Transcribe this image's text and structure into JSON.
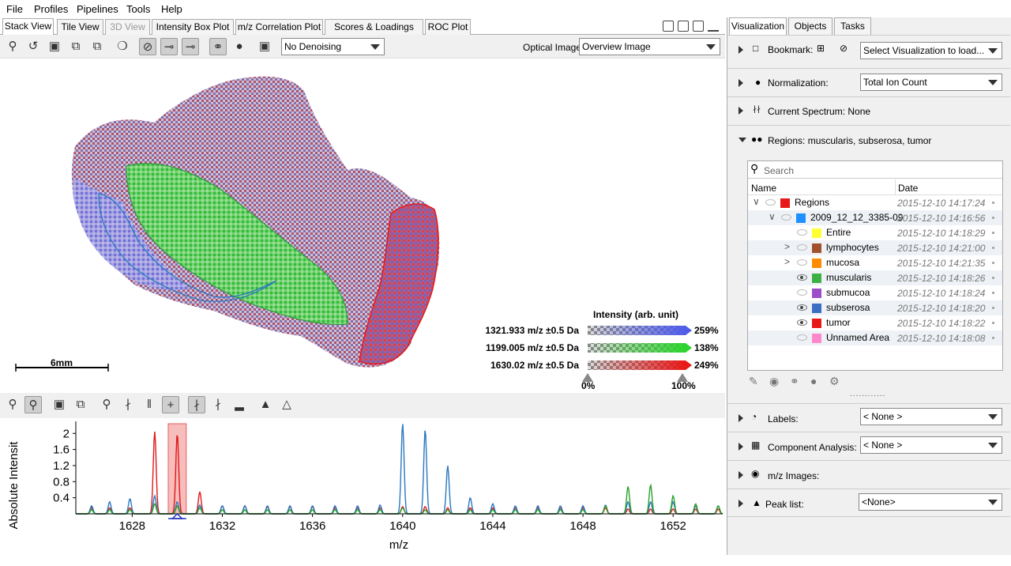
{
  "menu": [
    "File",
    "Profiles",
    "Pipelines",
    "Tools",
    "Help"
  ],
  "tabs": [
    {
      "label": "Stack View",
      "active": true
    },
    {
      "label": "Tile View"
    },
    {
      "label": "3D View",
      "disabled": true
    },
    {
      "label": "Intensity Box Plot"
    },
    {
      "label": "m/z Correlation Plot"
    },
    {
      "label": "Scores & Loadings Plot"
    },
    {
      "label": "ROC Plot"
    }
  ],
  "toolbar": {
    "denoise_value": "No Denoising",
    "optical_label": "Optical Image:",
    "optical_value": "Overview Image"
  },
  "image": {
    "scalebar_label": "6mm",
    "legend_title": "Intensity (arb. unit)",
    "channels": [
      {
        "label": "1321.933 m/z ±0.5 Da",
        "percent": "259%",
        "color": "#4f5ce8"
      },
      {
        "label": "1199.005 m/z ±0.5 Da",
        "percent": "138%",
        "color": "#2dd42d"
      },
      {
        "label": "1630.02 m/z ±0.5 Da",
        "percent": "249%",
        "color": "#e81818"
      }
    ],
    "range_min": "0%",
    "range_max": "100%"
  },
  "chart_data": {
    "type": "line",
    "xlabel": "m/z",
    "ylabel": "Absolute Intensit",
    "xlim": [
      1625.5,
      1654.2
    ],
    "ylim": [
      0,
      2.3
    ],
    "xticks": [
      1628,
      1632,
      1636,
      1640,
      1644,
      1648,
      1652
    ],
    "yticks": [
      0.4,
      0.8,
      1.2,
      1.6,
      2
    ],
    "series": [
      {
        "color": "#e01818",
        "peaks": [
          [
            1626.2,
            0.15
          ],
          [
            1627.0,
            0.15
          ],
          [
            1627.9,
            0.15
          ],
          [
            1629.0,
            2.05
          ],
          [
            1630.0,
            2.0
          ],
          [
            1631.0,
            0.55
          ],
          [
            1632.0,
            0.2
          ],
          [
            1633.0,
            0.2
          ],
          [
            1634.0,
            0.18
          ],
          [
            1635.0,
            0.18
          ],
          [
            1636.0,
            0.18
          ],
          [
            1637.0,
            0.15
          ],
          [
            1638.0,
            0.15
          ],
          [
            1639.0,
            0.15
          ],
          [
            1640.0,
            0.18
          ],
          [
            1641.0,
            0.18
          ],
          [
            1642.0,
            0.15
          ],
          [
            1643.0,
            0.15
          ],
          [
            1644.0,
            0.15
          ],
          [
            1645.0,
            0.15
          ],
          [
            1646.0,
            0.15
          ],
          [
            1647.0,
            0.15
          ],
          [
            1648.0,
            0.15
          ],
          [
            1649.0,
            0.15
          ],
          [
            1650.0,
            0.12
          ],
          [
            1651.0,
            0.12
          ],
          [
            1652.0,
            0.12
          ],
          [
            1653.0,
            0.12
          ],
          [
            1654.0,
            0.12
          ]
        ]
      },
      {
        "color": "#2a78c0",
        "peaks": [
          [
            1626.2,
            0.2
          ],
          [
            1627.0,
            0.3
          ],
          [
            1627.9,
            0.38
          ],
          [
            1629.0,
            0.45
          ],
          [
            1630.0,
            0.3
          ],
          [
            1631.0,
            0.22
          ],
          [
            1632.0,
            0.2
          ],
          [
            1633.0,
            0.2
          ],
          [
            1634.0,
            0.2
          ],
          [
            1635.0,
            0.2
          ],
          [
            1636.0,
            0.2
          ],
          [
            1637.0,
            0.2
          ],
          [
            1638.0,
            0.2
          ],
          [
            1639.0,
            0.22
          ],
          [
            1640.0,
            2.25
          ],
          [
            1641.0,
            2.1
          ],
          [
            1642.0,
            1.2
          ],
          [
            1643.0,
            0.4
          ],
          [
            1644.0,
            0.25
          ],
          [
            1645.0,
            0.2
          ],
          [
            1646.0,
            0.2
          ],
          [
            1647.0,
            0.2
          ],
          [
            1648.0,
            0.2
          ],
          [
            1649.0,
            0.22
          ],
          [
            1650.0,
            0.3
          ],
          [
            1651.0,
            0.3
          ],
          [
            1652.0,
            0.3
          ],
          [
            1653.0,
            0.2
          ],
          [
            1654.0,
            0.2
          ]
        ]
      },
      {
        "color": "#2aa02a",
        "peaks": [
          [
            1626.2,
            0.1
          ],
          [
            1627.0,
            0.1
          ],
          [
            1627.9,
            0.1
          ],
          [
            1629.0,
            0.25
          ],
          [
            1630.0,
            0.2
          ],
          [
            1631.0,
            0.15
          ],
          [
            1632.0,
            0.1
          ],
          [
            1633.0,
            0.1
          ],
          [
            1634.0,
            0.1
          ],
          [
            1635.0,
            0.1
          ],
          [
            1636.0,
            0.1
          ],
          [
            1637.0,
            0.1
          ],
          [
            1638.0,
            0.1
          ],
          [
            1639.0,
            0.1
          ],
          [
            1640.0,
            0.15
          ],
          [
            1641.0,
            0.1
          ],
          [
            1642.0,
            0.1
          ],
          [
            1643.0,
            0.1
          ],
          [
            1644.0,
            0.1
          ],
          [
            1645.0,
            0.1
          ],
          [
            1646.0,
            0.1
          ],
          [
            1647.0,
            0.1
          ],
          [
            1648.0,
            0.1
          ],
          [
            1649.0,
            0.2
          ],
          [
            1650.0,
            0.68
          ],
          [
            1651.0,
            0.72
          ],
          [
            1652.0,
            0.45
          ],
          [
            1653.0,
            0.25
          ],
          [
            1654.0,
            0.2
          ]
        ]
      }
    ],
    "highlight": [
      1629.6,
      1630.4
    ]
  },
  "right": {
    "tabs": [
      {
        "label": "Visualization",
        "active": true
      },
      {
        "label": "Objects"
      },
      {
        "label": "Tasks"
      }
    ],
    "bookmark_label": "Bookmark:",
    "bookmark_value": "Select Visualization to load...",
    "normalization_label": "Normalization:",
    "normalization_value": "Total Ion Count",
    "spectrum_label": "Current Spectrum: None",
    "regions_label": "Regions: muscularis, subserosa, tumor",
    "search_placeholder": "Search",
    "col_name": "Name",
    "col_date": "Date",
    "tree": [
      {
        "name": "Regions",
        "date": "2015-12-10 14:17:24",
        "color": "#e81818",
        "indent": 0,
        "expanded": true,
        "visible": false
      },
      {
        "name": "2009_12_12_3385-09",
        "date": "2015-12-10 14:16:56",
        "color": "#1e90ff",
        "indent": 1,
        "expanded": true,
        "visible": false
      },
      {
        "name": "Entire",
        "date": "2015-12-10 14:18:29",
        "color": "#ffff33",
        "indent": 2,
        "visible": false
      },
      {
        "name": "lymphocytes",
        "date": "2015-12-10 14:21:00",
        "color": "#a0522d",
        "indent": 2,
        "collapsed": true,
        "visible": false
      },
      {
        "name": "mucosa",
        "date": "2015-12-10 14:21:35",
        "color": "#ff8c00",
        "indent": 2,
        "collapsed": true,
        "visible": false
      },
      {
        "name": "muscularis",
        "date": "2015-12-10 14:18:26",
        "color": "#3cb043",
        "indent": 2,
        "visible": true
      },
      {
        "name": "submucoa",
        "date": "2015-12-10 14:18:24",
        "color": "#9b4dca",
        "indent": 2,
        "visible": false
      },
      {
        "name": "subserosa",
        "date": "2015-12-10 14:18:20",
        "color": "#3a6fc4",
        "indent": 2,
        "visible": true
      },
      {
        "name": "tumor",
        "date": "2015-12-10 14:18:22",
        "color": "#e81818",
        "indent": 2,
        "visible": true
      },
      {
        "name": "Unnamed Area",
        "date": "2015-12-10 14:18:08",
        "color": "#ff88cc",
        "indent": 2,
        "visible": false
      }
    ],
    "labels_label": "Labels:",
    "labels_value": "< None >",
    "component_label": "Component Analysis:",
    "component_value": "< None >",
    "mz_images_label": "m/z Images:",
    "peak_list_label": "Peak list:",
    "peak_list_value": "<None>"
  }
}
